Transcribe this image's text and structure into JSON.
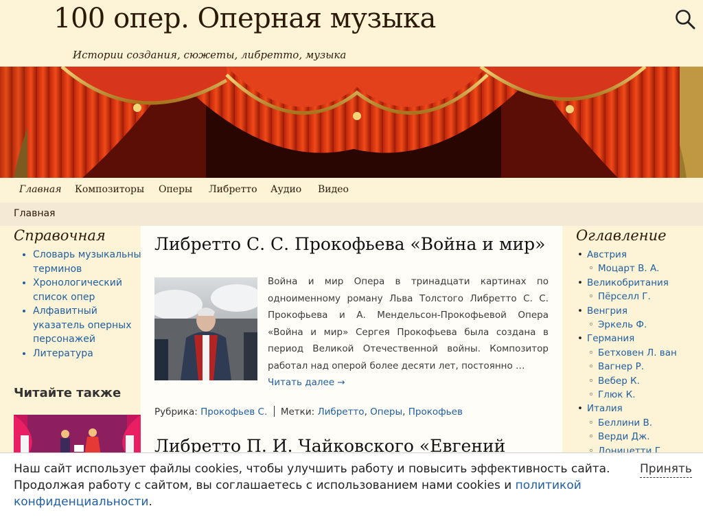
{
  "site": {
    "title": "100 опер. Оперная музыка",
    "tagline": "Истории создания, сюжеты, либретто, музыка"
  },
  "header": {
    "search_icon": "search-icon"
  },
  "nav": {
    "items": [
      {
        "label": "Главная",
        "active": true
      },
      {
        "label": "Композиторы",
        "active": false
      },
      {
        "label": "Оперы",
        "active": false
      },
      {
        "label": "Либретто",
        "active": false
      },
      {
        "label": "Аудио",
        "active": false
      },
      {
        "label": "Видео",
        "active": false
      }
    ]
  },
  "breadcrumb": {
    "label": "Главная"
  },
  "left_sidebar": {
    "title": "Справочная",
    "items": [
      {
        "label": "Словарь музыкальных терминов"
      },
      {
        "label": "Хронологический список опер"
      },
      {
        "label": "Алфавитный указатель оперных персонажей"
      },
      {
        "label": "Литература"
      }
    ],
    "read_also_title": "Читайте также"
  },
  "posts": [
    {
      "title": "Либретто С. С. Прокофьева «Война и мир»",
      "excerpt": "Война и мир Опера в тринадцати картинах по одноименному роману Льва Толстого Либретто С. С. Прокофьева и А. Мендельсон-Прокофьевой Опера «Война и мир» Сергея Прокофьева была создана в период Великой Отечественной войны. Композитор работал над оперой более десяти лет, постоянно …",
      "read_more": "Читать далее →",
      "category_label": "Рубрика:",
      "category": "Прокофьев С.",
      "tags_label": "Метки:",
      "tags": [
        "Либретто",
        "Оперы",
        "Прокофьев"
      ]
    },
    {
      "title": "Либретто П. И. Чайковского «Евгений"
    }
  ],
  "right_sidebar": {
    "title": "Оглавление",
    "countries": [
      {
        "name": "Австрия",
        "composers": [
          "Моцарт В. А."
        ]
      },
      {
        "name": "Великобритания",
        "composers": [
          "Пёрселл Г."
        ]
      },
      {
        "name": "Венгрия",
        "composers": [
          "Эркель Ф."
        ]
      },
      {
        "name": "Германия",
        "composers": [
          "Бетховен Л. ван",
          "Вагнер Р.",
          "Вебер К.",
          "Глюк К."
        ]
      },
      {
        "name": "Италия",
        "composers": [
          "Беллини В.",
          "Верди Дж.",
          "Доницетти Г."
        ]
      }
    ]
  },
  "cookie": {
    "text": "Наш сайт использует файлы cookies, чтобы улучшить работу и повысить эффективность сайта. Продолжая работу с сайтом, вы соглашаетесь с использованием нами cookies и ",
    "link": "политикой конфиденциальности",
    "tail": ".",
    "accept": "Принять"
  }
}
